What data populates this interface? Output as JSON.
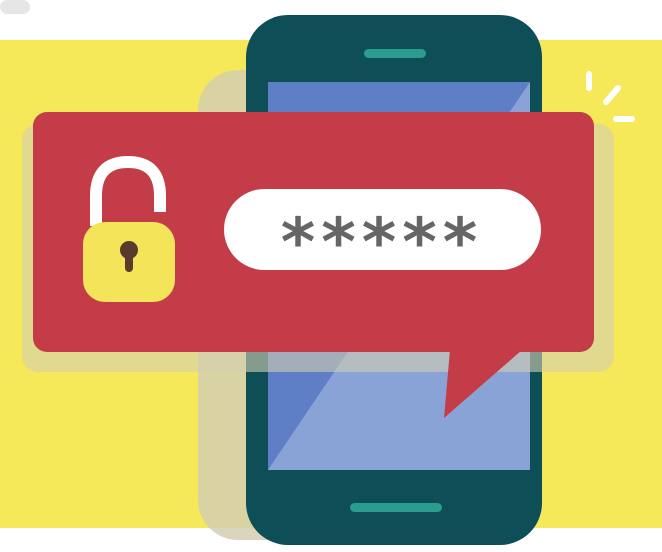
{
  "password_field": {
    "masked_value": "*****"
  },
  "icons": {
    "lock": "padlock-open-icon",
    "sparkle": "sparkle-lines-icon"
  },
  "colors": {
    "background_band": "#f5e95a",
    "band_shadow": "#d8d24a",
    "phone_body": "#0e4f57",
    "phone_screen": "#5e7ec6",
    "phone_screen_light": "#8aa3d6",
    "phone_accent": "#2a9d8f",
    "bubble": "#c33c47",
    "lock_body": "#f3e45a",
    "lock_shackle": "#ffffff",
    "keyhole": "#5a3a2a",
    "field_bg": "#ffffff",
    "field_text": "#666666",
    "shadow": "#d3ceb0"
  }
}
